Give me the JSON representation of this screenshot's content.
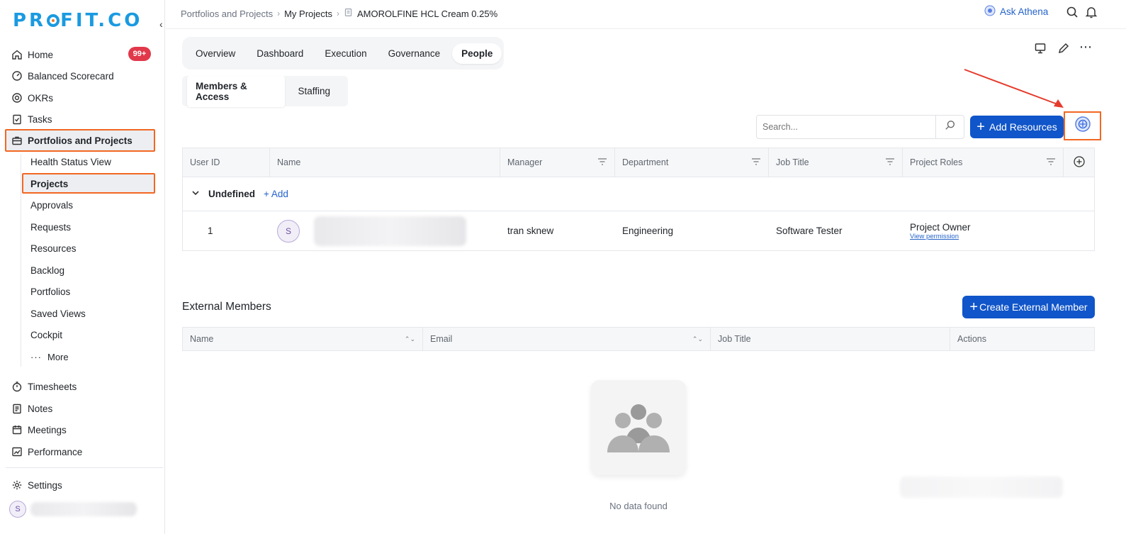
{
  "app": {
    "logo": "PROFIT.CO"
  },
  "sidebar": {
    "home": "Home",
    "home_badge": "99+",
    "balanced_scorecard": "Balanced Scorecard",
    "okrs": "OKRs",
    "tasks": "Tasks",
    "portfolios_and_projects": "Portfolios and Projects",
    "sub_items": [
      "Health Status View",
      "Projects",
      "Approvals",
      "Requests",
      "Resources",
      "Backlog",
      "Portfolios",
      "Saved Views",
      "Cockpit"
    ],
    "more": "More",
    "timesheets": "Timesheets",
    "notes": "Notes",
    "meetings": "Meetings",
    "performance": "Performance",
    "settings": "Settings",
    "user_initial": "S"
  },
  "breadcrumb": {
    "level1": "Portfolios and Projects",
    "level2": "My Projects",
    "current": "AMOROLFINE HCL Cream 0.25%"
  },
  "header": {
    "ask_athena": "Ask Athena"
  },
  "tabs": [
    "Overview",
    "Dashboard",
    "Execution",
    "Governance",
    "People"
  ],
  "subtabs": [
    "Members & Access",
    "Staffing"
  ],
  "search": {
    "placeholder": "Search..."
  },
  "buttons": {
    "add_resources": "Add Resources",
    "create_external_member": "Create External Member",
    "add": "Add"
  },
  "members_table": {
    "columns": [
      "User ID",
      "Name",
      "Manager",
      "Department",
      "Job Title",
      "Project Roles"
    ],
    "group": "Undefined",
    "rows": [
      {
        "user_id": "1",
        "avatar_initial": "S",
        "manager": "tran sknew",
        "department": "Engineering",
        "job_title": "Software Tester",
        "role": "Project Owner",
        "role_link": "View permission"
      }
    ]
  },
  "external_members": {
    "title": "External Members",
    "columns": [
      "Name",
      "Email",
      "Job Title",
      "Actions"
    ],
    "empty_text": "No data found"
  },
  "colors": {
    "primary": "#1055c9",
    "highlight": "#f26722",
    "badge": "#e1384a",
    "arrow": "#e53b2c"
  }
}
